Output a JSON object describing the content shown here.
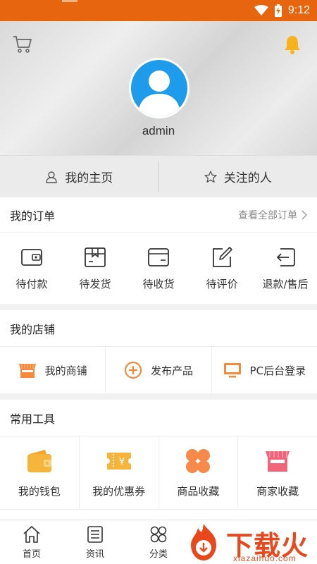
{
  "status_bar": {
    "time": "9:12",
    "icons": [
      "wifi-icon",
      "battery-charging-icon"
    ],
    "background": "#e8650f"
  },
  "header": {
    "username": "admin",
    "icons": [
      "cart-icon",
      "bell-icon",
      "avatar-icon"
    ]
  },
  "home_row": [
    {
      "label": "我的主页",
      "icon": "user-icon"
    },
    {
      "label": "关注的人",
      "icon": "star-icon"
    }
  ],
  "orders": {
    "title": "我的订单",
    "more_label": "查看全部订单",
    "items": [
      {
        "label": "待付款",
        "icon": "wallet-outline-icon"
      },
      {
        "label": "待发货",
        "icon": "package-icon"
      },
      {
        "label": "待收货",
        "icon": "card-box-icon"
      },
      {
        "label": "待评价",
        "icon": "edit-review-icon"
      },
      {
        "label": "退款/售后",
        "icon": "return-icon"
      }
    ]
  },
  "shop": {
    "title": "我的店铺",
    "items": [
      {
        "label": "我的商铺",
        "icon": "storefront-icon"
      },
      {
        "label": "发布产品",
        "icon": "add-circle-icon"
      },
      {
        "label": "PC后台登录",
        "icon": "monitor-icon"
      }
    ]
  },
  "tools": {
    "title": "常用工具",
    "items": [
      {
        "label": "我的钱包",
        "icon": "wallet-icon",
        "color": "#f5b53c"
      },
      {
        "label": "我的优惠券",
        "icon": "coupon-icon",
        "color": "#f5b53c"
      },
      {
        "label": "商品收藏",
        "icon": "clover-icon",
        "color": "#f78a4a"
      },
      {
        "label": "商家收藏",
        "icon": "shop-collect-icon",
        "color": "#f0657a"
      }
    ]
  },
  "tabbar": [
    {
      "label": "首页",
      "icon": "home-icon"
    },
    {
      "label": "资讯",
      "icon": "news-icon"
    },
    {
      "label": "分类",
      "icon": "category-icon"
    }
  ],
  "watermark": {
    "title": "下载火",
    "subtitle": "xiazaihuo.com"
  },
  "colors": {
    "accent": "#e8650f",
    "avatar_blue": "#1e9bea",
    "icon_orange": "#f7893a"
  }
}
